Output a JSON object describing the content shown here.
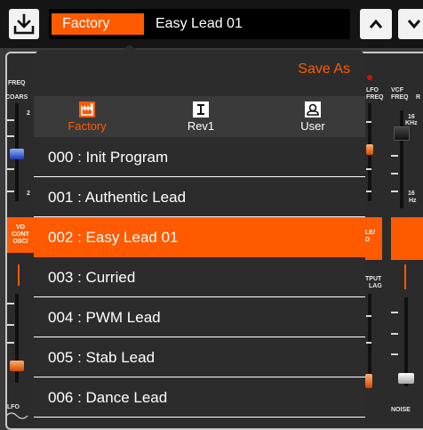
{
  "header": {
    "bank": "Factory",
    "preset_name": "Easy Lead 01"
  },
  "panel_labels": {
    "freq_left": "FREQ",
    "coarse": "COARS",
    "coarse_tick_top": "2",
    "coarse_tick_bottom": "2",
    "vco_control_1": "VO",
    "vco_control_2": "CONT",
    "vco_control_3": "OSCI",
    "lfo_freq_1": "LFO",
    "lfo_freq_2": "FREQ",
    "vcf_freq_1": "VCF",
    "vcf_freq_2": "FREQ",
    "vcf_res": "R",
    "vcf_top_value": "16",
    "vcf_top_unit": "KHz",
    "vcf_bottom_value": "16",
    "vcf_bottom_unit": "Hz",
    "env_block_1": "LE/",
    "env_block_2": "D",
    "output_1": "TPUT",
    "output_2": "LAG",
    "lfo_bottom": "LFO",
    "noise": "NOISE"
  },
  "popover": {
    "save_as_label": "Save As",
    "tabs": [
      {
        "label": "Factory",
        "icon": "factory-icon",
        "active": true
      },
      {
        "label": "Rev1",
        "icon": "rev1-icon",
        "active": false
      },
      {
        "label": "User",
        "icon": "user-icon",
        "active": false
      }
    ],
    "presets": [
      "000 : Init Program",
      "001 : Authentic Lead",
      "002 : Easy Lead 01",
      "003 : Curried",
      "004 : PWM Lead",
      "005 : Stab Lead",
      "006 : Dance Lead"
    ],
    "selected_index": 2
  },
  "colors": {
    "accent": "#ff5a00",
    "popover_bg": "#2c2c2c",
    "tab_bar_bg": "#3a3a3a",
    "topbar_bg": "#151515"
  }
}
